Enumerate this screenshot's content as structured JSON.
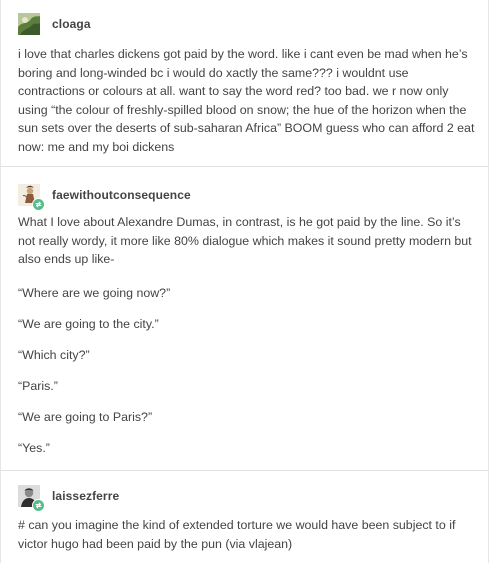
{
  "posts": [
    {
      "username": "cloaga",
      "avatar_colors": [
        "#3c5a2c",
        "#6f8f4a",
        "#c9d4a8"
      ],
      "body": "i love that charles dickens got paid by the word. like i cant even be mad when he’s boring and long-winded bc i would do xactly the same??? i wouldnt use contractions or colours at all. want to say the word red? too bad. we r now only using “the colour of freshly-spilled blood on snow; the hue of the horizon when the sun sets over the deserts of sub-saharan Africa” BOOM guess who can afford 2 eat now: me and my boi dickens"
    },
    {
      "username": "faewithoutconsequence",
      "avatar_colors": [
        "#e8d9c4",
        "#8a5a3a",
        "#c9a27a"
      ],
      "badge_color": "#56bc8a",
      "intro": "What I love about Alexandre Dumas, in contrast, is he got paid by the line. So it’s not really wordy, it more like 80% dialogue which makes it sound pretty modern but also ends up like-",
      "lines": [
        "“Where are we going now?”",
        "“We are going to the city.”",
        "“Which city?”",
        "“Paris.”",
        "“We are going to Paris?”",
        "“Yes.”"
      ]
    },
    {
      "username": "laissezferre",
      "avatar_colors": [
        "#d8d8d8",
        "#2e2e2e",
        "#8a8a8a"
      ],
      "badge_color": "#56bc8a",
      "body": "# can you imagine the kind of extended torture we would have been subject to if victor hugo had been paid by the pun (via vlajean)"
    }
  ]
}
